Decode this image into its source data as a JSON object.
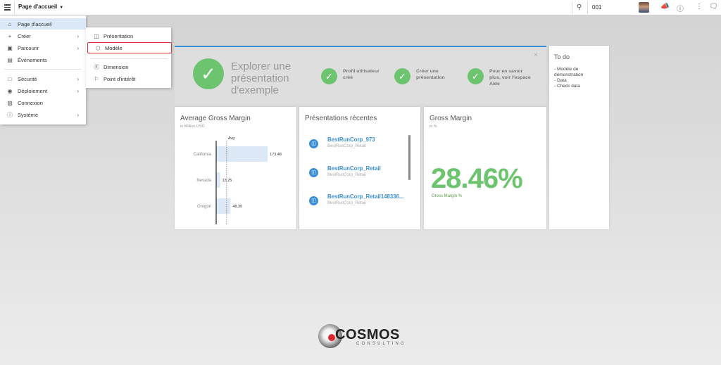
{
  "topbar": {
    "title": "Page d'accueil",
    "search_value": "001"
  },
  "menu": {
    "items": [
      {
        "label": "Page d'accueil",
        "icon": "home-icon"
      },
      {
        "label": "Créer",
        "icon": "plus-icon"
      },
      {
        "label": "Parcourir",
        "icon": "browse-icon"
      },
      {
        "label": "Événements",
        "icon": "calendar-icon"
      },
      {
        "label": "Sécurité",
        "icon": "lock-icon"
      },
      {
        "label": "Déploiement",
        "icon": "deploy-icon"
      },
      {
        "label": "Connexion",
        "icon": "connection-icon"
      },
      {
        "label": "Système",
        "icon": "info-icon"
      }
    ]
  },
  "submenu": {
    "items": [
      {
        "label": "Présentation",
        "icon": "presentation-icon"
      },
      {
        "label": "Modèle",
        "icon": "model-cube-icon"
      },
      {
        "label": "Dimension",
        "icon": "dimension-icon"
      },
      {
        "label": "Point d'intérêt",
        "icon": "flag-icon"
      }
    ]
  },
  "explore": {
    "title": "Explorer une présentation d'exemple",
    "steps": [
      {
        "label": "Profil utilisateur créé"
      },
      {
        "label": "Créer une présentation"
      },
      {
        "label": "Pour en savoir plus, voir l'espace Aide"
      }
    ],
    "close": "×"
  },
  "cards": {
    "gross_margin_chart": {
      "title": "Average Gross Margin",
      "subtitle": "in Million USD"
    },
    "recent": {
      "title": "Présentations récentes",
      "items": [
        {
          "name": "BestRunCorp_973",
          "desc": "BestRunCorp_Retail"
        },
        {
          "name": "BestRunCorp_Retail",
          "desc": "BestRunCorp_Retail"
        },
        {
          "name": "BestRunCorp_Retail148336...",
          "desc": "BestRunCorp_Retail"
        }
      ]
    },
    "kpi": {
      "title": "Gross Margin",
      "subtitle": "in %",
      "value": "28.46%",
      "label": "Gross Margin %"
    }
  },
  "todo": {
    "title": "To do",
    "items": [
      "- Modèle de démonstration",
      "- Data",
      "- Check data"
    ]
  },
  "chart_data": {
    "type": "bar",
    "orientation": "horizontal",
    "title": "Average Gross Margin",
    "subtitle": "in Million USD",
    "categories": [
      "California",
      "Nevada",
      "Oregon"
    ],
    "values": [
      173.48,
      13.25,
      48.3
    ],
    "value_labels": [
      "173.48",
      "13.25",
      "48.30"
    ],
    "reference_line": {
      "label": "Avg",
      "value": 78.34
    },
    "xlim": [
      0,
      185
    ],
    "bar_color": "#dce8f5"
  },
  "logo": {
    "name": "COSMOS",
    "tagline": "CONSULTING"
  },
  "colors": {
    "accent": "#3a8fd6",
    "success": "#6cc56e",
    "highlight": "#d9303a"
  }
}
